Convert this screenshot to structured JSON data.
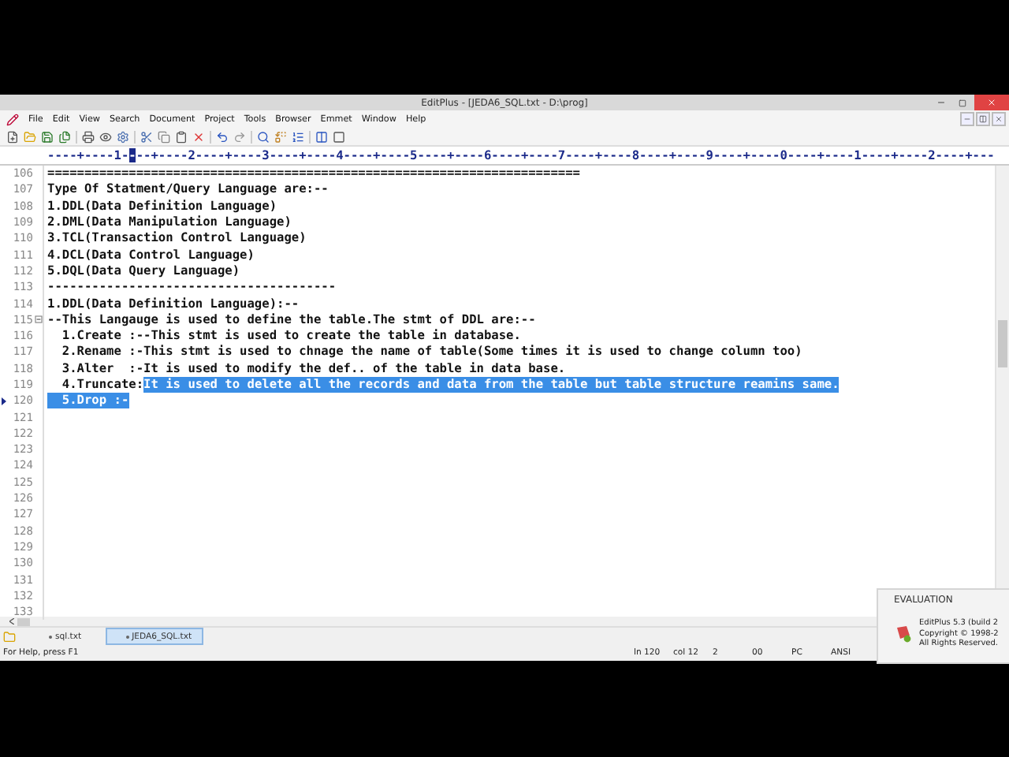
{
  "window": {
    "title": "EditPlus - [JEDA6_SQL.txt - D:\\prog]"
  },
  "menu": [
    "File",
    "Edit",
    "View",
    "Search",
    "Document",
    "Project",
    "Tools",
    "Browser",
    "Emmet",
    "Window",
    "Help"
  ],
  "ruler": [
    {
      "text": "----+----1-",
      "selected": false
    },
    {
      "text": "-",
      "selected": true
    },
    {
      "text": "--+----2----+----3----+----4----+----5----+----6----+----7----+----8----+----9----+----0----+----1----+----2----+---",
      "selected": false
    }
  ],
  "lines": [
    {
      "number": "106",
      "segments": [
        {
          "text": "========================================================================",
          "selected": false
        }
      ]
    },
    {
      "number": "107",
      "segments": [
        {
          "text": "Type Of Statment/Query Language are:--",
          "selected": false
        }
      ]
    },
    {
      "number": "108",
      "segments": [
        {
          "text": "1.DDL(Data Definition Language)",
          "selected": false
        }
      ]
    },
    {
      "number": "109",
      "segments": [
        {
          "text": "2.DML(Data Manipulation Language)",
          "selected": false
        }
      ]
    },
    {
      "number": "110",
      "segments": [
        {
          "text": "3.TCL(Transaction Control Language)",
          "selected": false
        }
      ]
    },
    {
      "number": "111",
      "segments": [
        {
          "text": "4.DCL(Data Control Language)",
          "selected": false
        }
      ]
    },
    {
      "number": "112",
      "segments": [
        {
          "text": "5.DQL(Data Query Language)",
          "selected": false
        }
      ]
    },
    {
      "number": "113",
      "segments": [
        {
          "text": "---------------------------------------",
          "selected": false
        }
      ]
    },
    {
      "number": "114",
      "segments": [
        {
          "text": "1.DDL(Data Definition Language):--",
          "selected": false
        }
      ]
    },
    {
      "number": "115",
      "fold": true,
      "segments": [
        {
          "text": "--This Langauge is used to define the table.The stmt of DDL are:--",
          "selected": false
        }
      ]
    },
    {
      "number": "116",
      "segments": [
        {
          "text": "  1.Create :--This stmt is used to create the table in database.",
          "selected": false
        }
      ]
    },
    {
      "number": "117",
      "segments": [
        {
          "text": "  2.Rename :-This stmt is used to chnage the name of table(Some times it is used to change column too)",
          "selected": false
        }
      ]
    },
    {
      "number": "118",
      "segments": [
        {
          "text": "  3.Alter  :-It is used to modify the def.. of the table in data base.",
          "selected": false
        }
      ]
    },
    {
      "number": "119",
      "segments": [
        {
          "text": "  4.Truncate:",
          "selected": false
        },
        {
          "text": "It is used to delete all the records and data from the table but table structure reamins same.",
          "selected": true
        }
      ]
    },
    {
      "number": "120",
      "current": true,
      "segments": [
        {
          "text": "  5.Drop :-",
          "selected": true
        }
      ]
    },
    {
      "number": "121"
    },
    {
      "number": "122"
    },
    {
      "number": "123"
    },
    {
      "number": "124"
    },
    {
      "number": "125"
    },
    {
      "number": "126"
    },
    {
      "number": "127"
    },
    {
      "number": "128"
    },
    {
      "number": "129"
    },
    {
      "number": "130"
    },
    {
      "number": "131"
    },
    {
      "number": "132"
    },
    {
      "number": "133"
    }
  ],
  "tabs": [
    {
      "label": "sql.txt",
      "selected": false
    },
    {
      "label": "JEDA6_SQL.txt",
      "selected": true
    }
  ],
  "status_bar": {
    "message": "For Help, press F1",
    "cells": [
      "ln 120",
      "col 12",
      "2",
      "00",
      "PC",
      "ANSI"
    ]
  },
  "evaluation_popup": {
    "title": "EVALUATION",
    "lines": [
      "EditPlus 5.3 (build 2",
      "Copyright © 1998-2",
      "All Rights Reserved."
    ]
  }
}
